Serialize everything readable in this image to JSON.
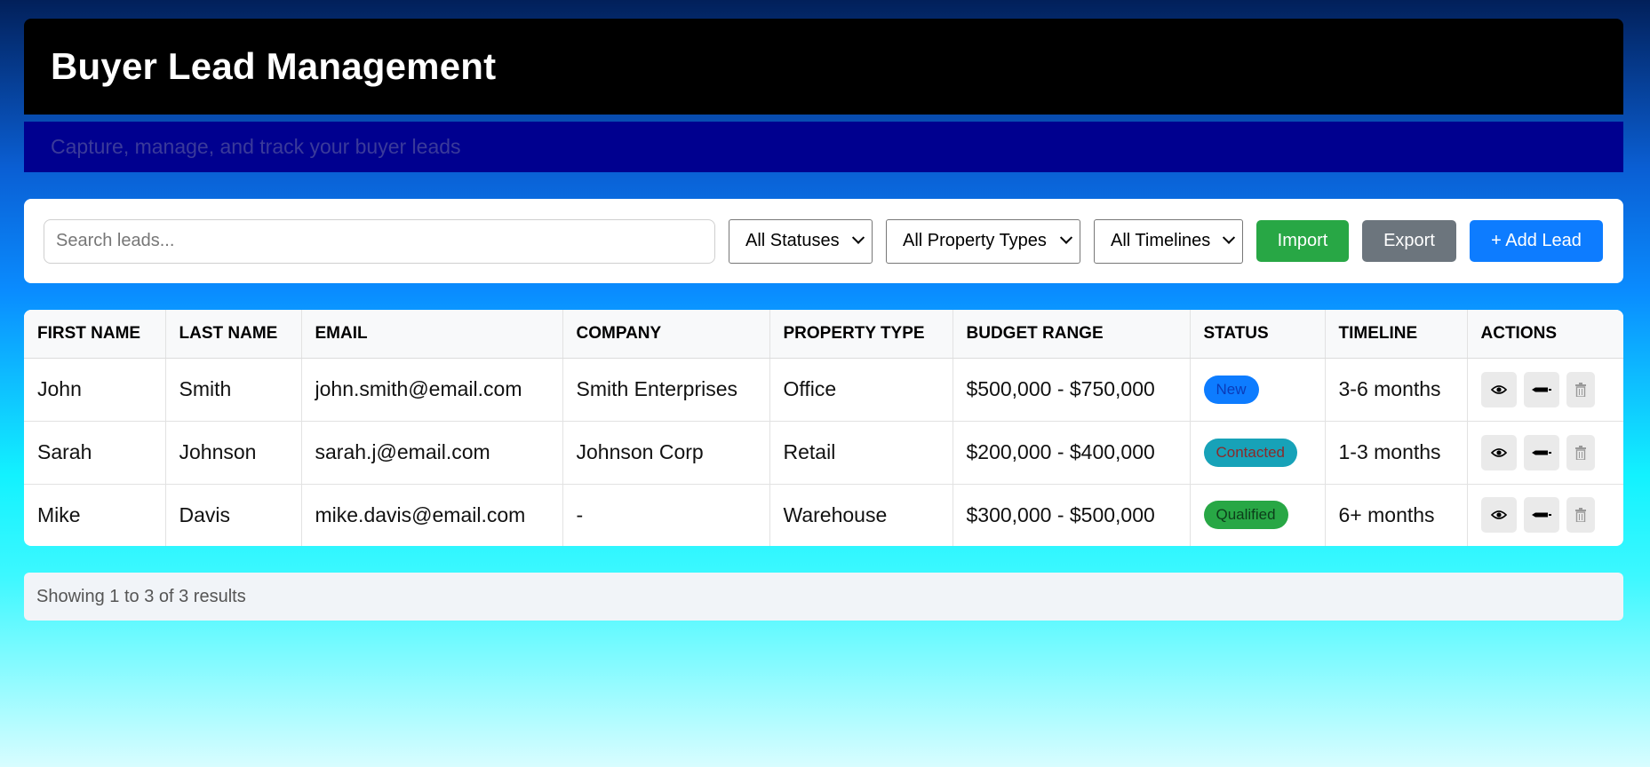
{
  "header": {
    "title": "Buyer Lead Management"
  },
  "subtitle": "Capture, manage, and track your buyer leads",
  "toolbar": {
    "search_placeholder": "Search leads...",
    "status_filter": "All Statuses",
    "property_filter": "All Property Types",
    "timeline_filter": "All Timelines",
    "import_label": "Import",
    "export_label": "Export",
    "add_label": "+ Add Lead"
  },
  "table": {
    "columns": [
      "FIRST NAME",
      "LAST NAME",
      "EMAIL",
      "COMPANY",
      "PROPERTY TYPE",
      "BUDGET RANGE",
      "STATUS",
      "TIMELINE",
      "ACTIONS"
    ],
    "rows": [
      {
        "first": "John",
        "last": "Smith",
        "email": "john.smith@email.com",
        "company": "Smith Enterprises",
        "property": "Office",
        "budget": "$500,000 - $750,000",
        "status": "New",
        "timeline": "3-6 months"
      },
      {
        "first": "Sarah",
        "last": "Johnson",
        "email": "sarah.j@email.com",
        "company": "Johnson Corp",
        "property": "Retail",
        "budget": "$200,000 - $400,000",
        "status": "Contacted",
        "timeline": "1-3 months"
      },
      {
        "first": "Mike",
        "last": "Davis",
        "email": "mike.davis@email.com",
        "company": "-",
        "property": "Warehouse",
        "budget": "$300,000 - $500,000",
        "status": "Qualified",
        "timeline": "6+ months"
      }
    ],
    "action_icons": [
      "eye-icon",
      "edit-icon",
      "trash-icon"
    ]
  },
  "footer": {
    "text": "Showing 1 to 3 of 3 results"
  },
  "colors": {
    "import": "#28a745",
    "export": "#6c757d",
    "add": "#0d7cff",
    "status_new": "#0d7cff",
    "status_contacted": "#17a2b8",
    "status_qualified": "#28a745"
  }
}
